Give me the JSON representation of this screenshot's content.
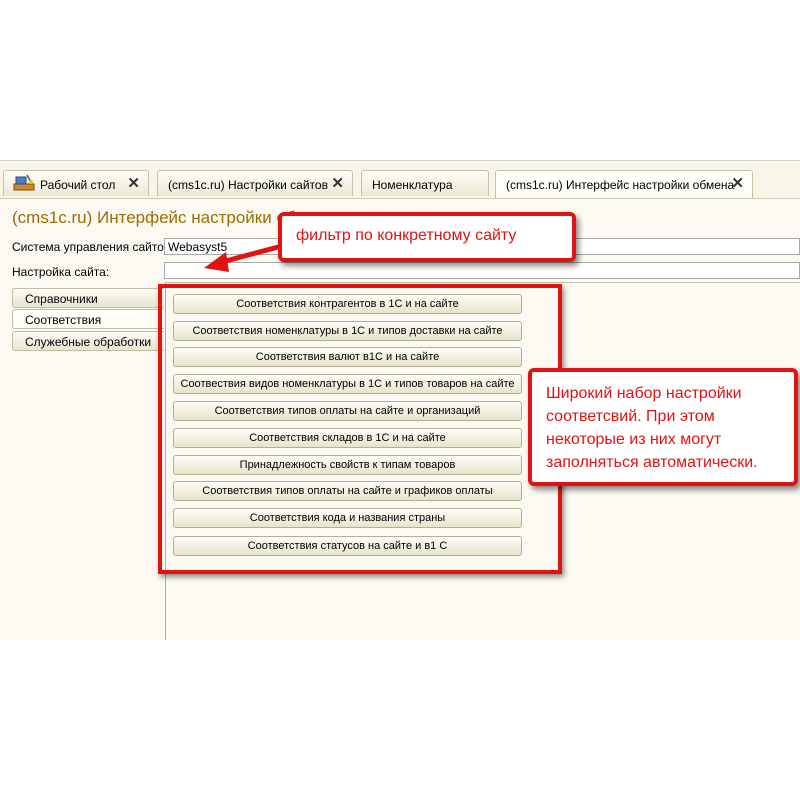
{
  "tabs": [
    {
      "label": "Рабочий стол",
      "closable": true,
      "icon": "home-desk-icon"
    },
    {
      "label": "(cms1c.ru) Настройки сайтов",
      "closable": true
    },
    {
      "label": "Номенклатура",
      "closable": false
    },
    {
      "label": "(cms1c.ru) Интерфейс настройки обмена",
      "closable": true,
      "active": true
    }
  ],
  "page_title": "(cms1c.ru) Интерфейс настройки обмена",
  "fields": {
    "cms_label": "Система управления сайтом:",
    "cms_value": "Webasyst5",
    "site_label": "Настройка сайта:",
    "site_value": ""
  },
  "sidebar": {
    "items": [
      {
        "label": "Справочники"
      },
      {
        "label": "Соответствия",
        "active": true
      },
      {
        "label": "Служебные обработки"
      }
    ]
  },
  "buttons": [
    {
      "label": "Соответствия контрагентов в 1С и на сайте"
    },
    {
      "label": "Соответствия номенклатуры в 1С и типов доставки на сайте"
    },
    {
      "label": "Соответствия валют в1С и на сайте"
    },
    {
      "label": "Соотвествия видов номенклатуры в 1С и типов товаров на сайте"
    },
    {
      "label": "Соответствия типов оплаты на сайте и организаций"
    },
    {
      "label": "Соответствия складов в 1С и на сайте"
    },
    {
      "label": "Принадлежность свойств к типам товаров"
    },
    {
      "label": "Соответствия типов оплаты на сайте и графиков оплаты"
    },
    {
      "label": "Соответствия кода и названия страны"
    },
    {
      "label": "Соответствия статусов на сайте и в1 С"
    }
  ],
  "annotations": {
    "filter_note": "фильтр по конкретному сайту",
    "settings_note": {
      "lines": [
        "Широкий набор настройки",
        "соответсвий. При этом",
        "некоторые из них могут",
        "заполняться автоматически."
      ]
    },
    "accent_color": "#e11212"
  },
  "colors": {
    "title": "#9b6e00",
    "background": "#fbf9f1"
  }
}
